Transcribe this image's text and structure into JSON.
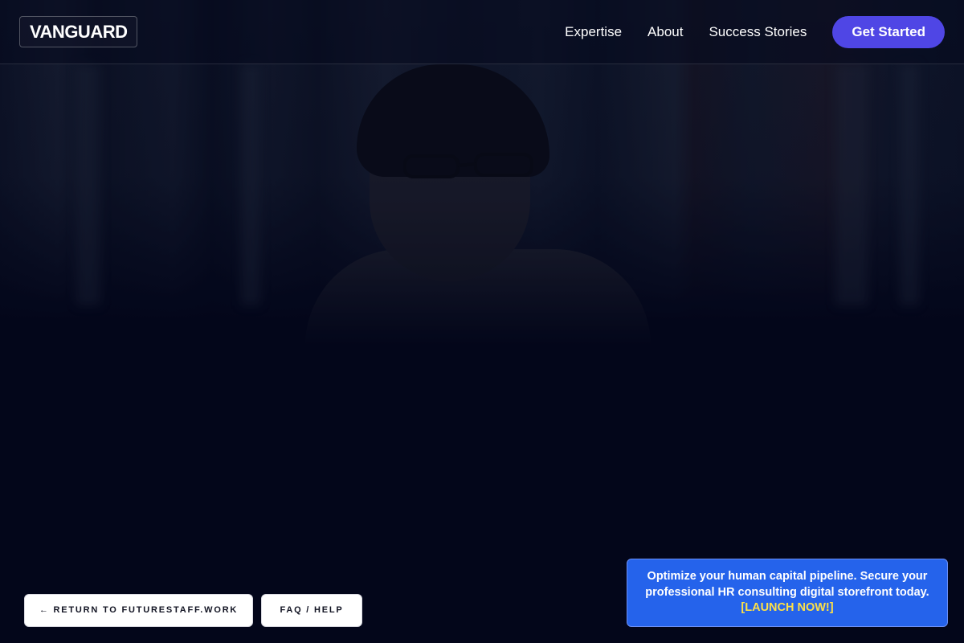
{
  "header": {
    "logo": "VANGUARD",
    "nav": [
      {
        "label": "Expertise"
      },
      {
        "label": "About"
      },
      {
        "label": "Success Stories"
      }
    ],
    "cta_label": "Get Started"
  },
  "footer_buttons": {
    "return_label": "← RETURN TO FUTURESTAFF.WORK",
    "faq_label": "FAQ / HELP"
  },
  "promo": {
    "text": "Optimize your human capital pipeline. Secure your professional HR consulting digital storefront today.",
    "link": "[LAUNCH NOW!]"
  },
  "colors": {
    "background": "#03061a",
    "accent": "#4f46e5",
    "promo": "#2563eb",
    "promo_link": "#fde047"
  }
}
